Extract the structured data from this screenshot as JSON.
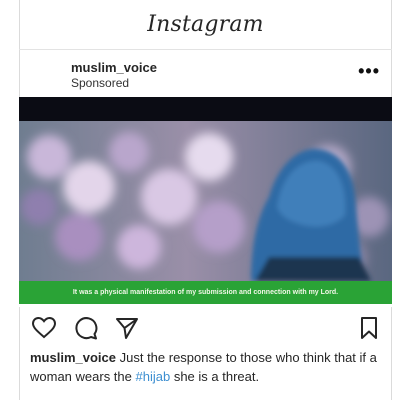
{
  "app": {
    "logo_text": "Instagram"
  },
  "post": {
    "username": "muslim_voice",
    "sponsored_label": "Sponsored",
    "more_label": "•••",
    "video_caption": "It was a physical manifestation of my submission and connection with my Lord.",
    "caption": {
      "username": "muslim_voice",
      "text_before": " Just the response to those who think that if a woman wears the ",
      "hashtag": "#hijab",
      "text_after": " she is a threat."
    }
  },
  "icons": {
    "like": "heart-icon",
    "comment": "comment-icon",
    "share": "send-icon",
    "save": "bookmark-icon"
  },
  "colors": {
    "caption_bar": "#2aa336",
    "hashtag": "#3d8fd1",
    "hijab": "#2d6aa5"
  }
}
